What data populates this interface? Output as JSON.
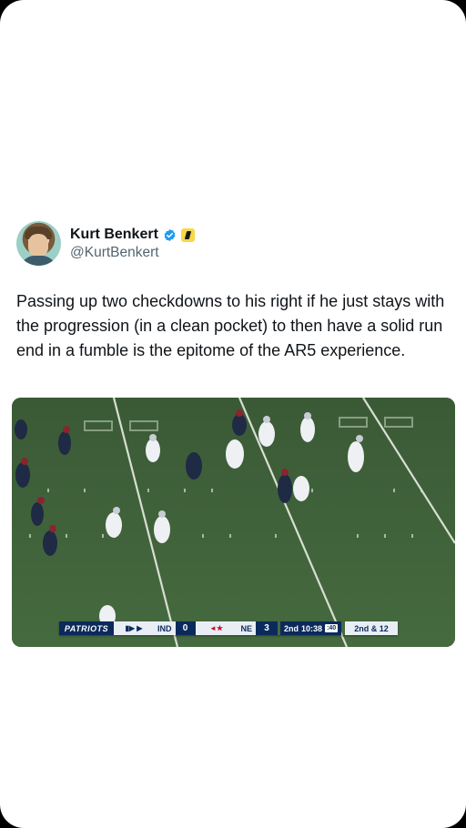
{
  "author": {
    "name": "Kurt Benkert",
    "handle": "@KurtBenkert",
    "avatar_icon": "profile-photo",
    "verified_icon": "verified-badge-icon",
    "affiliation_icon": "affiliation-badge-icon"
  },
  "tweet": {
    "text": "Passing up two checkdowns to his right if he just stays with the progression (in a clean pocket) to then have a solid run end in a fumble is the epitome of the AR5 experience."
  },
  "media": {
    "type": "video-frame",
    "scorebug": {
      "home_team": "PATRIOTS",
      "away_abbr": "IND",
      "away_score": "0",
      "home_abbr": "NE",
      "home_score": "3",
      "quarter": "2nd",
      "clock": "10:38",
      "play_clock": ":40",
      "down_distance": "2nd & 12"
    }
  },
  "colors": {
    "accent_blue": "#1d9bf0",
    "patriots_navy": "#0b2a5c",
    "field_green": "#3f5a3a"
  }
}
